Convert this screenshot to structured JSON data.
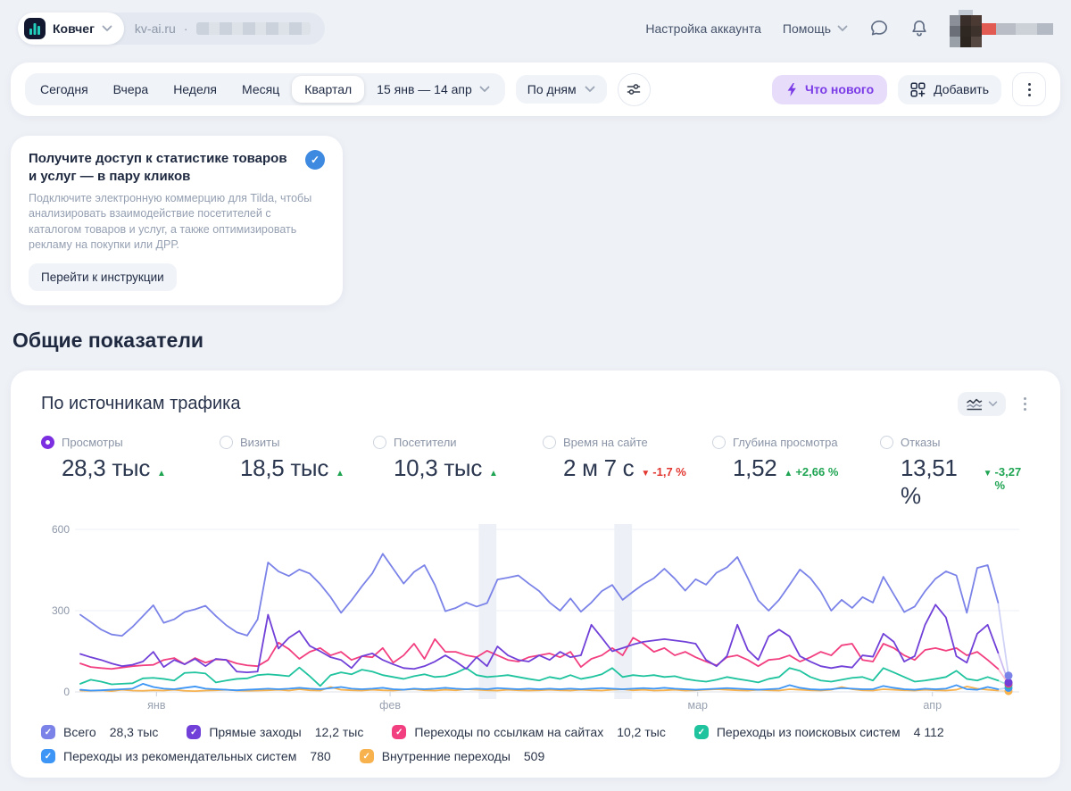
{
  "header": {
    "counter_name": "Ковчег",
    "site": "kv-ai.ru",
    "separator": "·",
    "account_settings": "Настройка аккаунта",
    "help": "Помощь"
  },
  "filters": {
    "periods": [
      "Сегодня",
      "Вчера",
      "Неделя",
      "Месяц",
      "Квартал"
    ],
    "active_period": "Квартал",
    "date_range": "15 янв — 14 апр",
    "granularity": "По дням",
    "whats_new": "Что нового",
    "add": "Добавить"
  },
  "promo": {
    "title": "Получите доступ к статистике товаров и услуг — в пару кликов",
    "body": "Подключите электронную коммерцию для Tilda, чтобы анализировать взаимодействие посетителей с каталогом товаров и услуг, а также оптимизировать рекламу на покупки или ДРР.",
    "button": "Перейти к инструкции"
  },
  "section_title": "Общие показатели",
  "card": {
    "title": "По источникам трафика"
  },
  "colors": {
    "accent_purple": "#7b3be6",
    "green": "#1ea452",
    "red": "#e2362f",
    "check_blue": "#3e8ae0",
    "radio_selected": "#7b2fe0"
  },
  "metrics": [
    {
      "label": "Просмотры",
      "value": "28,3 тыс",
      "delta": "",
      "dir": "up",
      "tone": "green",
      "selected": true
    },
    {
      "label": "Визиты",
      "value": "18,5 тыс",
      "delta": "",
      "dir": "up",
      "tone": "green",
      "selected": false
    },
    {
      "label": "Посетители",
      "value": "10,3 тыс",
      "delta": "",
      "dir": "up",
      "tone": "green",
      "selected": false
    },
    {
      "label": "Время на сайте",
      "value": "2 м 7 с",
      "delta": "-1,7 %",
      "dir": "down",
      "tone": "red",
      "selected": false
    },
    {
      "label": "Глубина просмотра",
      "value": "1,52",
      "delta": "+2,66 %",
      "dir": "up",
      "tone": "green",
      "selected": false
    },
    {
      "label": "Отказы",
      "value": "13,51 %",
      "delta": "-3,27 %",
      "dir": "down",
      "tone": "green",
      "selected": false
    }
  ],
  "chart_data": {
    "type": "line",
    "x_start": "15 янв",
    "x_end": "14 апр",
    "ylim": [
      0,
      600
    ],
    "yticks": [
      0,
      300,
      600
    ],
    "grid": true,
    "legend_position": "bottom",
    "month_labels": [
      {
        "label": "янв",
        "idx": 7.3
      },
      {
        "label": "фев",
        "idx": 29.7
      },
      {
        "label": "мар",
        "idx": 59.2
      },
      {
        "label": "апр",
        "idx": 81.7
      }
    ],
    "bands": [
      {
        "from": 38.2,
        "to": 39.9
      },
      {
        "from": 51.2,
        "to": 52.9
      }
    ],
    "legend_rows": [
      [
        0,
        1,
        2,
        3
      ],
      [
        4,
        5
      ]
    ],
    "series": [
      {
        "name": "Всего",
        "total": "28,3 тыс",
        "color": "#7b83e8",
        "values": [
          285,
          258,
          230,
          212,
          207,
          240,
          280,
          320,
          255,
          268,
          295,
          305,
          318,
          280,
          246,
          220,
          208,
          268,
          478,
          445,
          428,
          452,
          437,
          398,
          350,
          292,
          338,
          390,
          438,
          510,
          455,
          400,
          443,
          468,
          395,
          298,
          310,
          330,
          315,
          328,
          415,
          422,
          430,
          400,
          372,
          330,
          300,
          345,
          296,
          330,
          372,
          395,
          340,
          370,
          398,
          420,
          455,
          418,
          374,
          416,
          396,
          440,
          460,
          498,
          420,
          338,
          300,
          340,
          395,
          452,
          420,
          370,
          300,
          340,
          310,
          350,
          330,
          425,
          360,
          295,
          315,
          372,
          418,
          445,
          430,
          292,
          458,
          468,
          330,
          60
        ]
      },
      {
        "name": "Прямые заходы",
        "total": "12,2 тыс",
        "color": "#7040d8",
        "values": [
          140,
          128,
          118,
          105,
          95,
          100,
          112,
          148,
          92,
          118,
          102,
          122,
          95,
          122,
          118,
          75,
          72,
          75,
          285,
          160,
          200,
          225,
          170,
          150,
          128,
          118,
          88,
          132,
          142,
          118,
          102,
          88,
          85,
          95,
          112,
          135,
          112,
          85,
          128,
          95,
          168,
          135,
          118,
          112,
          135,
          118,
          148,
          128,
          135,
          248,
          200,
          150,
          162,
          175,
          185,
          190,
          195,
          190,
          185,
          178,
          118,
          95,
          132,
          248,
          155,
          118,
          205,
          230,
          205,
          132,
          112,
          95,
          88,
          95,
          90,
          135,
          130,
          215,
          185,
          112,
          132,
          248,
          322,
          275,
          132,
          108,
          215,
          248,
          145,
          35
        ]
      },
      {
        "name": "Переходы по ссылкам на сайтах",
        "total": "10,2 тыс",
        "color": "#f23f80",
        "values": [
          105,
          92,
          88,
          85,
          90,
          95,
          98,
          100,
          118,
          125,
          102,
          125,
          108,
          120,
          118,
          105,
          98,
          95,
          118,
          182,
          158,
          122,
          148,
          162,
          135,
          148,
          118,
          132,
          128,
          162,
          108,
          135,
          178,
          122,
          195,
          148,
          148,
          135,
          128,
          152,
          135,
          118,
          112,
          128,
          135,
          142,
          128,
          148,
          92,
          122,
          135,
          162,
          135,
          200,
          178,
          148,
          162,
          135,
          148,
          128,
          112,
          98,
          128,
          135,
          118,
          95,
          118,
          122,
          135,
          112,
          128,
          148,
          135,
          172,
          178,
          118,
          112,
          178,
          162,
          135,
          118,
          155,
          162,
          152,
          162,
          135,
          148,
          118,
          85,
          30
        ]
      },
      {
        "name": "Переходы из поисковых систем",
        "total": "4 112",
        "color": "#1fc39e",
        "values": [
          30,
          45,
          38,
          28,
          30,
          32,
          50,
          52,
          48,
          42,
          70,
          72,
          68,
          35,
          42,
          48,
          50,
          62,
          65,
          62,
          58,
          90,
          58,
          22,
          62,
          72,
          65,
          82,
          75,
          62,
          55,
          48,
          58,
          65,
          55,
          58,
          70,
          88,
          62,
          55,
          58,
          62,
          55,
          48,
          42,
          55,
          48,
          62,
          48,
          55,
          65,
          88,
          55,
          62,
          58,
          62,
          55,
          58,
          48,
          42,
          38,
          45,
          55,
          48,
          42,
          35,
          48,
          55,
          88,
          78,
          55,
          42,
          38,
          45,
          52,
          55,
          42,
          88,
          72,
          55,
          38,
          42,
          48,
          55,
          78,
          48,
          42,
          55,
          42,
          25
        ]
      },
      {
        "name": "Переходы из рекомендательных систем",
        "total": "780",
        "color": "#3d95f5",
        "values": [
          8,
          5,
          6,
          8,
          10,
          12,
          30,
          18,
          12,
          10,
          15,
          20,
          12,
          10,
          8,
          6,
          8,
          10,
          12,
          10,
          12,
          15,
          12,
          10,
          14,
          18,
          12,
          10,
          12,
          15,
          10,
          8,
          12,
          10,
          12,
          15,
          12,
          10,
          12,
          10,
          14,
          12,
          10,
          12,
          10,
          12,
          10,
          12,
          10,
          12,
          14,
          12,
          10,
          12,
          14,
          12,
          15,
          12,
          10,
          8,
          10,
          12,
          14,
          12,
          10,
          8,
          10,
          12,
          25,
          15,
          10,
          8,
          10,
          14,
          12,
          10,
          10,
          22,
          15,
          10,
          8,
          12,
          10,
          12,
          25,
          10,
          8,
          18,
          10,
          15
        ]
      },
      {
        "name": "Внутренние переходы",
        "total": "509",
        "color": "#f7b24e",
        "values": [
          5,
          4,
          6,
          3,
          8,
          5,
          4,
          6,
          5,
          8,
          4,
          3,
          5,
          6,
          8,
          5,
          4,
          5,
          6,
          8,
          5,
          10,
          6,
          5,
          18,
          8,
          6,
          5,
          8,
          6,
          5,
          8,
          10,
          6,
          5,
          8,
          6,
          10,
          8,
          6,
          5,
          8,
          6,
          5,
          6,
          8,
          6,
          5,
          8,
          6,
          5,
          8,
          10,
          6,
          8,
          5,
          6,
          8,
          5,
          6,
          8,
          10,
          8,
          6,
          5,
          8,
          6,
          5,
          10,
          8,
          6,
          5,
          8,
          18,
          10,
          6,
          5,
          10,
          8,
          6,
          5,
          8,
          6,
          5,
          8,
          20,
          12,
          8,
          5,
          3
        ]
      }
    ]
  }
}
